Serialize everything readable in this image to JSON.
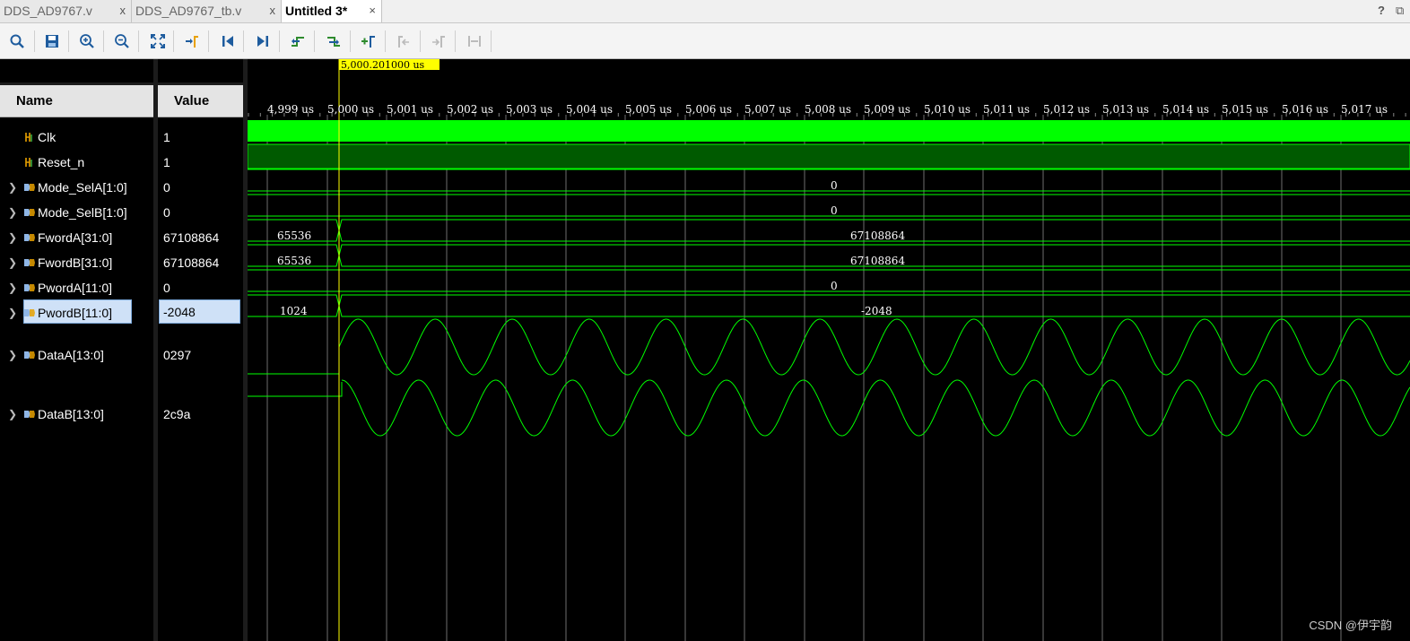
{
  "tabs": [
    {
      "label": "DDS_AD9767.v",
      "close": "x",
      "active": false
    },
    {
      "label": "DDS_AD9767_tb.v",
      "close": "x",
      "active": false
    },
    {
      "label": "Untitled 3*",
      "close": "×",
      "active": true
    }
  ],
  "window_controls": {
    "help": "?",
    "restore": "⧉"
  },
  "toolbar": [
    {
      "name": "search-icon"
    },
    {
      "name": "save-icon"
    },
    {
      "name": "zoom-in-icon"
    },
    {
      "name": "zoom-out-icon"
    },
    {
      "name": "zoom-fit-icon"
    },
    {
      "name": "go-to-cursor-icon"
    },
    {
      "name": "go-to-time-zero-icon"
    },
    {
      "name": "go-to-last-time-icon"
    },
    {
      "name": "previous-transition-icon"
    },
    {
      "name": "next-transition-icon"
    },
    {
      "name": "add-marker-icon"
    },
    {
      "name": "previous-marker-icon"
    },
    {
      "name": "next-marker-icon"
    },
    {
      "name": "swap-cursors-icon"
    }
  ],
  "columns": {
    "name": "Name",
    "value": "Value"
  },
  "cursor": {
    "label": "5,000.201000 us"
  },
  "time_ticks": [
    "4,999 us",
    "5,000 us",
    "5,001 us",
    "5,002 us",
    "5,003 us",
    "5,004 us",
    "5,005 us",
    "5,006 us",
    "5,007 us",
    "5,008 us",
    "5,009 us",
    "5,010 us",
    "5,011 us",
    "5,012 us",
    "5,013 us",
    "5,014 us",
    "5,015 us",
    "5,016 us",
    "5,017 us"
  ],
  "signals": [
    {
      "name": "Clk",
      "value": "1",
      "kind": "bit",
      "expandable": false
    },
    {
      "name": "Reset_n",
      "value": "1",
      "kind": "bit",
      "expandable": false
    },
    {
      "name": "Mode_SelA[1:0]",
      "value": "0",
      "kind": "bus",
      "expandable": true,
      "segments": [
        "0"
      ]
    },
    {
      "name": "Mode_SelB[1:0]",
      "value": "0",
      "kind": "bus",
      "expandable": true,
      "segments": [
        "0"
      ]
    },
    {
      "name": "FwordA[31:0]",
      "value": "67108864",
      "kind": "bus",
      "expandable": true,
      "segments": [
        "65536",
        "67108864"
      ]
    },
    {
      "name": "FwordB[31:0]",
      "value": "67108864",
      "kind": "bus",
      "expandable": true,
      "segments": [
        "65536",
        "67108864"
      ]
    },
    {
      "name": "PwordA[11:0]",
      "value": "0",
      "kind": "bus",
      "expandable": true,
      "segments": [
        "0"
      ]
    },
    {
      "name": "PwordB[11:0]",
      "value": "-2048",
      "kind": "bus",
      "expandable": true,
      "selected": true,
      "segments": [
        "1024",
        "-2048"
      ]
    },
    {
      "name": "DataA[13:0]",
      "value": "0297",
      "kind": "analog",
      "expandable": true
    },
    {
      "name": "DataB[13:0]",
      "value": "2c9a",
      "kind": "analog",
      "expandable": true
    }
  ],
  "colors": {
    "wave": "#00ff00",
    "reset_fill": "#005a00",
    "cursor": "#ffff00",
    "selection": "#cfe1f7"
  },
  "watermark": "CSDN @伊宇韵"
}
